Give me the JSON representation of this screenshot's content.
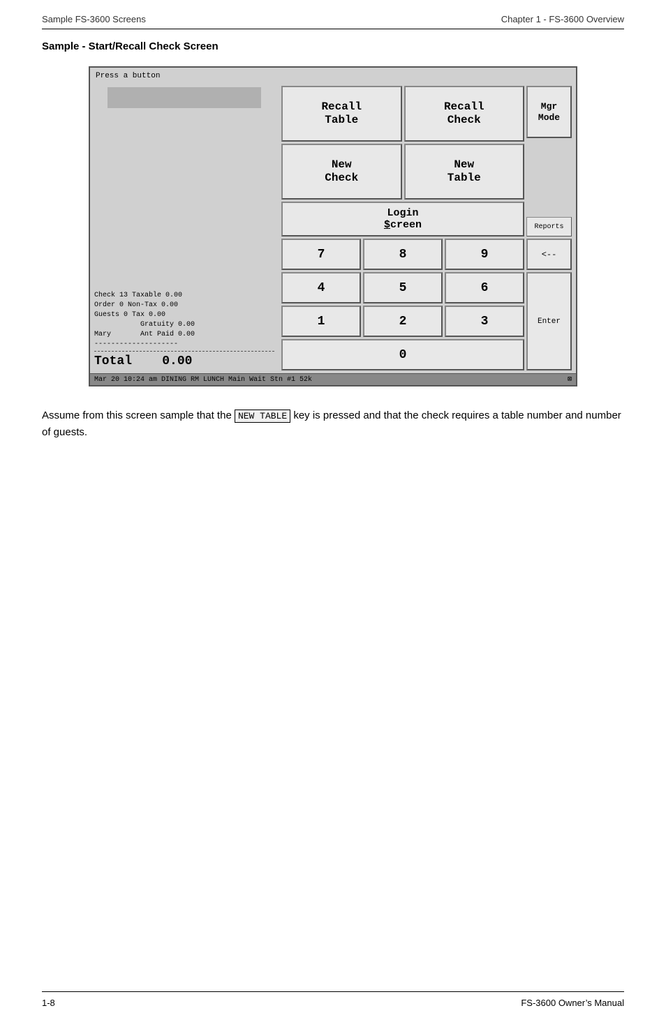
{
  "header": {
    "left": "Sample FS-3600 Screens",
    "right": "Chapter 1 - FS-3600 Overview"
  },
  "section_title": "Sample - Start/Recall Check Screen",
  "screen": {
    "prompt": "Press a button",
    "buttons": {
      "recall_table": "Recall\nTable",
      "recall_check": "Recall\nCheck",
      "new_check": "New\nCheck",
      "new_table": "New\nTable",
      "mgr_mode": "Mgr\nMode",
      "reports": "Reports",
      "login_screen": "Login\nScreen",
      "backspace": "<--",
      "enter": "Enter",
      "num7": "7",
      "num8": "8",
      "num9": "9",
      "num4": "4",
      "num5": "5",
      "num6": "6",
      "num1": "1",
      "num2": "2",
      "num3": "3",
      "num0": "0"
    },
    "info": {
      "check": "Check    13 Taxable   0.00",
      "order": "Order     0 Non-Tax   0.00",
      "guests": "Guests    0 Tax       0.00",
      "gratuity": "           Gratuity   0.00",
      "mary": "Mary       Ant Paid   0.00",
      "divider": "--------------------",
      "total_label": "Total",
      "total_value": "0.00"
    },
    "status_bar": "Mar 20 10:24 am  DINING RM   LUNCH     Main          Wait Stn #1   52k"
  },
  "description": {
    "text1": "Assume from this screen sample that the",
    "inline_key": "NEW TABLE",
    "text2": "key is pressed and that the check requires a table number and number of guests."
  },
  "footer": {
    "left": "1-8",
    "right": "FS-3600 Owner’s Manual"
  }
}
